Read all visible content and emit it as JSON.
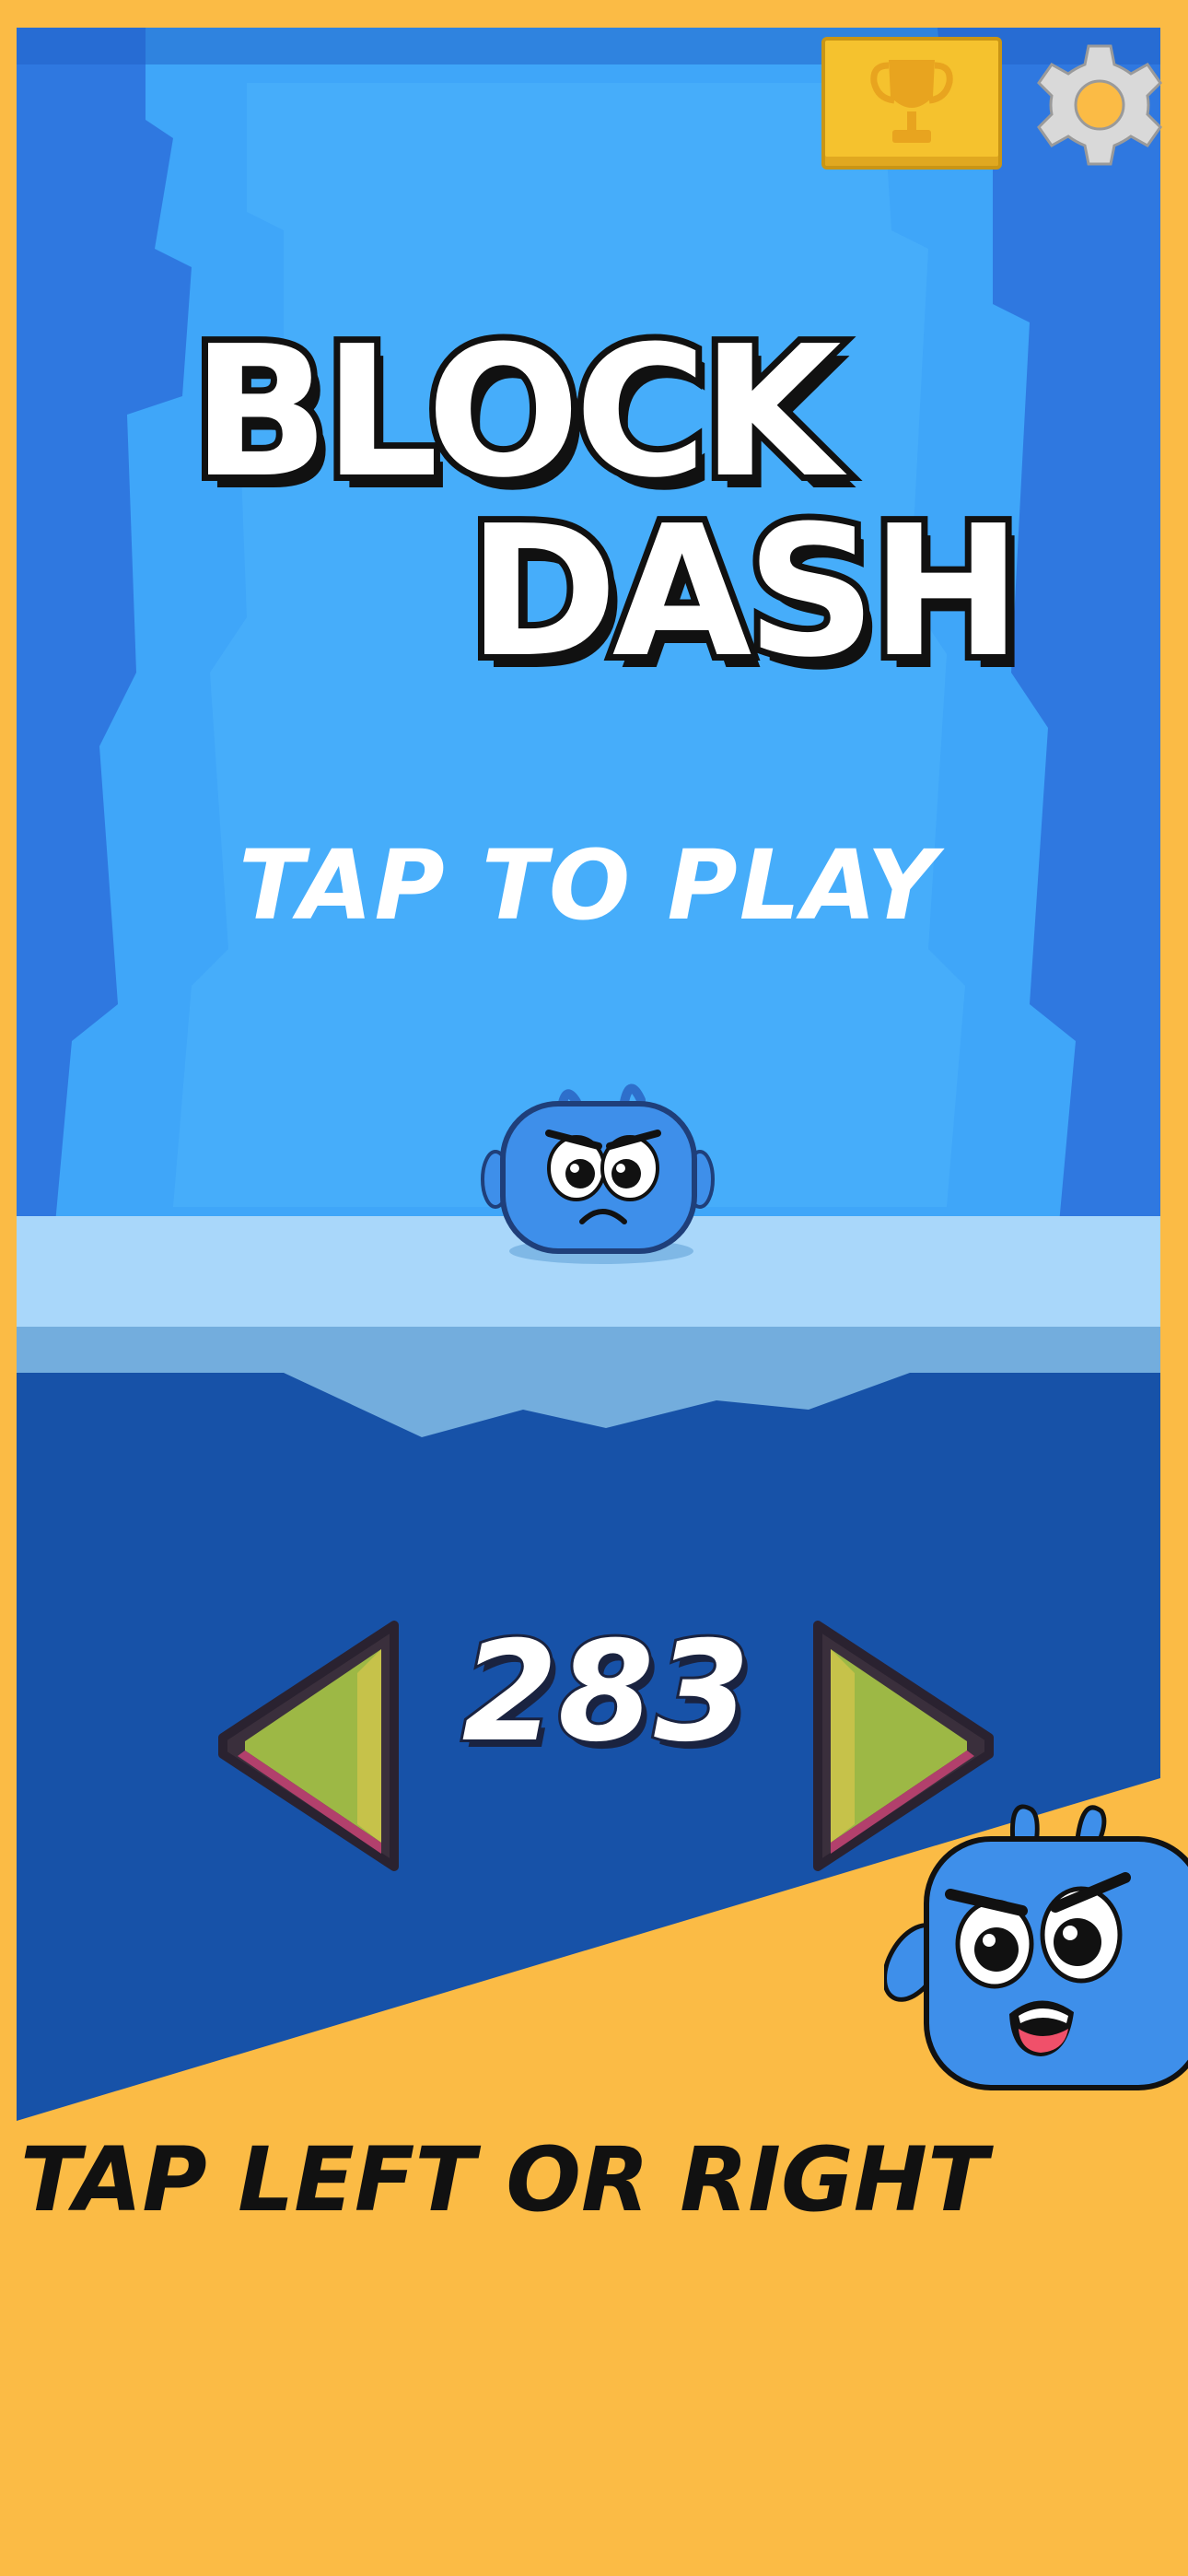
{
  "game": {
    "title_line1": "BLOCK",
    "title_line2": "DASH",
    "tap_prompt": "TAP TO PLAY",
    "score": "283"
  },
  "controls": {
    "trophy_icon": "trophy-icon",
    "settings_icon": "gear-icon",
    "left_icon": "left-arrow-icon",
    "right_icon": "right-arrow-icon"
  },
  "caption": {
    "instruction": "TAP LEFT OR RIGHT"
  },
  "colors": {
    "background": "#FBBB45",
    "sky_light": "#3FA6F9",
    "sky_dark": "#2F78E0",
    "platform": "#A9D7FA",
    "water": "#1752A8",
    "arrow_fill": "#9DB845",
    "character": "#3E8FEA"
  }
}
